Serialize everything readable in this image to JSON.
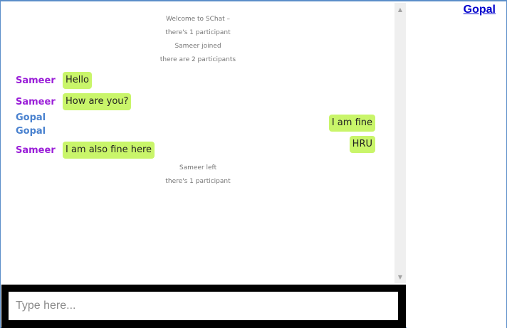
{
  "sidebar": {
    "current_user": "Gopal"
  },
  "system_messages": [
    "Welcome to SChat –",
    "there's 1 participant",
    "Sameer joined",
    "there are 2 participants",
    "Sameer left",
    "there's 1 participant"
  ],
  "messages": [
    {
      "sender": "Sameer",
      "text": "Hello",
      "side": "left"
    },
    {
      "sender": "Sameer",
      "text": "How are you?",
      "side": "left"
    },
    {
      "sender": "Gopal",
      "text": "I am fine",
      "side": "right"
    },
    {
      "sender": "Gopal",
      "text": "HRU",
      "side": "right"
    },
    {
      "sender": "Sameer",
      "text": "I am also fine here",
      "side": "left"
    }
  ],
  "input": {
    "placeholder": "Type here...",
    "value": ""
  },
  "colors": {
    "bubble": "#c9f56a",
    "sameer": "#9a1ed8",
    "gopal": "#4a82cf",
    "input_bar": "#000000",
    "link": "#0000cc"
  },
  "icons": {
    "scroll_up": "scroll-up-arrow-icon",
    "scroll_down": "scroll-down-arrow-icon"
  }
}
